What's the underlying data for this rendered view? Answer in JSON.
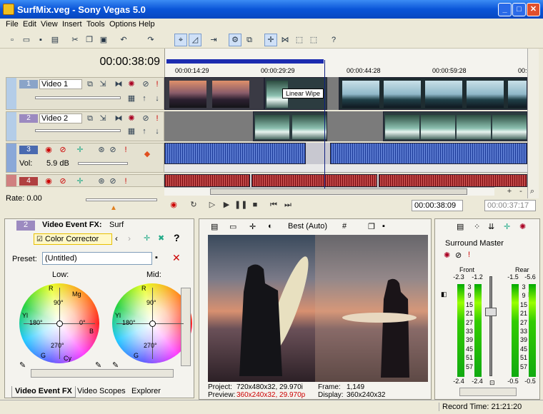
{
  "window": {
    "title": "SurfMix.veg - Sony Vegas 5.0",
    "minimize": "_",
    "maximize": "□",
    "close": "✕"
  },
  "menu": [
    "File",
    "Edit",
    "View",
    "Insert",
    "Tools",
    "Options",
    "Help"
  ],
  "timeline": {
    "timecode": "00:00:38:09",
    "ruler_ticks": [
      "00:00:14:29",
      "00:00:29:29",
      "00:00:44:28",
      "00:00:59:28",
      "00:01:"
    ],
    "transition_label": "Linear Wipe",
    "rate": "Rate: 0.00"
  },
  "tracks": [
    {
      "num": "1",
      "name": "Video 1",
      "kind": "video"
    },
    {
      "num": "2",
      "name": "Video 2",
      "kind": "video"
    },
    {
      "num": "3",
      "name": "",
      "kind": "audio",
      "vol_label": "Vol:",
      "vol_value": "5.9 dB"
    },
    {
      "num": "4",
      "name": "",
      "kind": "audio"
    }
  ],
  "transport": {
    "cursor": "00:00:38:09",
    "end": "00:00:37:17"
  },
  "fx": {
    "track_num": "2",
    "title": "Video Event FX:",
    "event": "Surf",
    "plugin": "Color Corrector",
    "preset_label": "Preset:",
    "preset_value": "(Untitled)",
    "low_label": "Low:",
    "mid_label": "Mid:",
    "wheel_labels": {
      "r": "R",
      "mg": "Mg",
      "yl": "Yl",
      "b": "B",
      "g": "G",
      "cy": "Cy",
      "a90": "90°",
      "a180": "180°",
      "a0": "0°",
      "a270": "270°"
    },
    "help": "?"
  },
  "preview": {
    "quality": "Best (Auto)",
    "project_label": "Project:",
    "project_value": "720x480x32, 29.970i",
    "preview_label": "Preview:",
    "preview_value": "360x240x32, 29.970p",
    "frame_label": "Frame:",
    "frame_value": "1,149",
    "display_label": "Display:",
    "display_value": "360x240x32",
    "preview_value_color": "#cc0000"
  },
  "mixer": {
    "title": "Surround Master",
    "front_label": "Front",
    "rear_label": "Rear",
    "front_peaks": [
      "-2.3",
      "-1.2"
    ],
    "rear_peaks": [
      "-1.5",
      "-5.6"
    ],
    "scale": [
      "3",
      "9",
      "15",
      "21",
      "27",
      "33",
      "39",
      "45",
      "51",
      "57"
    ],
    "front_bottom": [
      "-2.4",
      "-2.4"
    ],
    "rear_bottom": [
      "-0.5",
      "-0.5"
    ]
  },
  "tabs": [
    "Video Event FX",
    "Video Scopes",
    "Explorer"
  ],
  "status": {
    "record_time": "Record Time: 21:21:20"
  },
  "colors": {
    "titlebar": "#0a55d8",
    "loop_region": "#1c2cb0",
    "audio_wave_1": "#1c3a98",
    "audio_wave_2": "#a02020",
    "meter": "#22cc22"
  }
}
